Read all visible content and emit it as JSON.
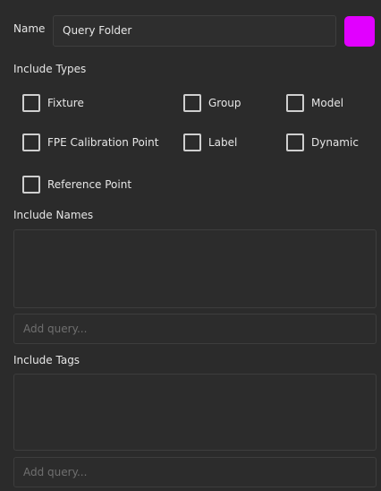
{
  "name_row": {
    "label": "Name",
    "value": "Query Folder",
    "swatch_color": "#e100ff"
  },
  "include_types": {
    "heading": "Include Types",
    "options": [
      {
        "label": "Fixture",
        "checked": false
      },
      {
        "label": "Group",
        "checked": false
      },
      {
        "label": "Model",
        "checked": false
      },
      {
        "label": "FPE Calibration Point",
        "checked": false
      },
      {
        "label": "Label",
        "checked": false
      },
      {
        "label": "Dynamic",
        "checked": false
      },
      {
        "label": "Reference Point",
        "checked": false
      }
    ]
  },
  "include_names": {
    "heading": "Include Names",
    "query_placeholder": "Add query..."
  },
  "include_tags": {
    "heading": "Include Tags",
    "query_placeholder": "Add query..."
  }
}
